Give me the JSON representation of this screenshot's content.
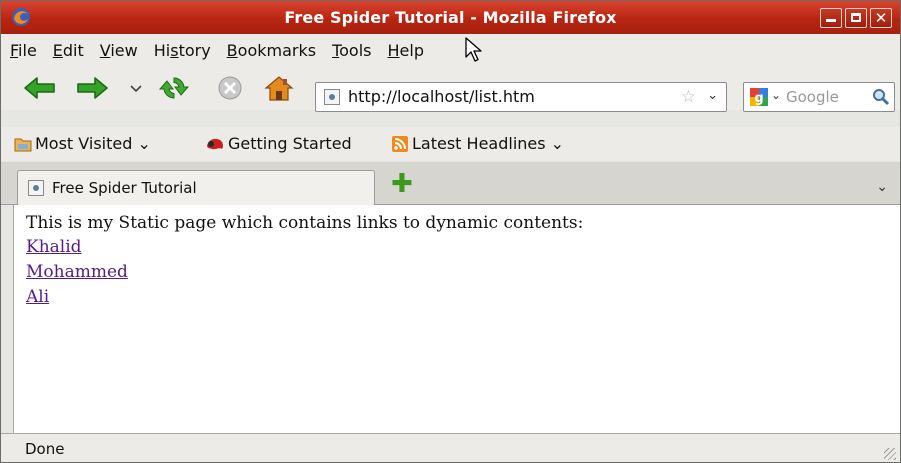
{
  "window": {
    "title": "Free Spider Tutorial - Mozilla Firefox",
    "buttons": [
      "minimize",
      "maximize",
      "close"
    ]
  },
  "menu": [
    {
      "label": "File",
      "u": "F",
      "rest": "ile"
    },
    {
      "label": "Edit",
      "u": "E",
      "rest": "dit"
    },
    {
      "label": "View",
      "u": "V",
      "rest": "iew"
    },
    {
      "label": "History",
      "pre": "Hi",
      "u": "s",
      "rest": "tory"
    },
    {
      "label": "Bookmarks",
      "u": "B",
      "rest": "ookmarks"
    },
    {
      "label": "Tools",
      "u": "T",
      "rest": "ools"
    },
    {
      "label": "Help",
      "u": "H",
      "rest": "elp"
    }
  ],
  "navigation": {
    "url": "http://localhost/list.htm",
    "search_placeholder": "Google",
    "icons": [
      "back-arrow-icon",
      "forward-arrow-icon",
      "history-dropdown-icon",
      "reload-icon",
      "stop-icon",
      "home-icon"
    ]
  },
  "bookmarks": {
    "most_visited": "Most Visited",
    "getting_started": "Getting Started",
    "latest_headlines": "Latest Headlines"
  },
  "tabs": [
    {
      "label": "Free Spider Tutorial",
      "active": true
    }
  ],
  "content": {
    "intro": "This is my Static page which contains links to dynamic contents:",
    "links": [
      "Khalid",
      "Mohammed",
      "Ali"
    ]
  },
  "status": {
    "text": "Done"
  },
  "colors": {
    "titlebar": "#b72512",
    "visited_link": "#551a8b",
    "nav_arrow_green": "#2f9a22"
  }
}
